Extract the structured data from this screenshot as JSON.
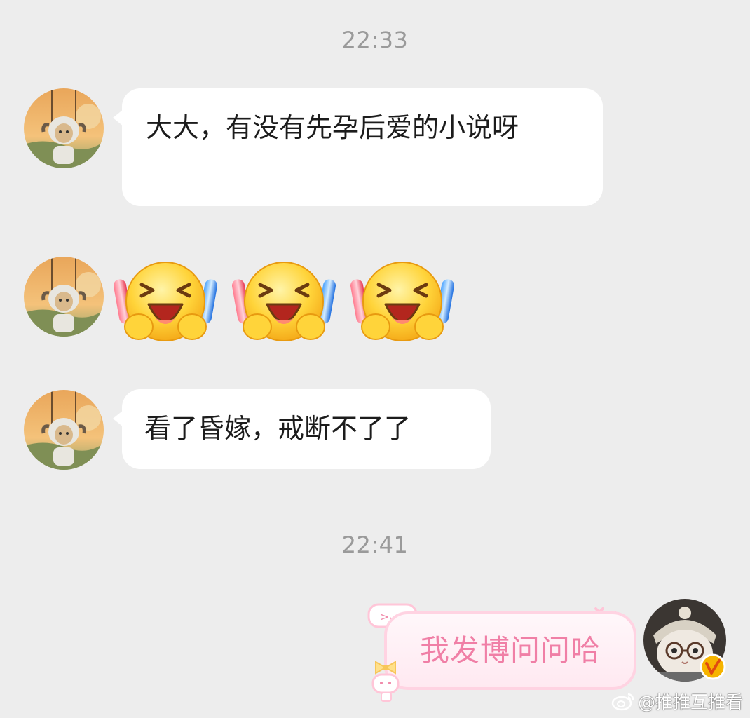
{
  "chat": {
    "timestamps": [
      "22:33",
      "22:41"
    ],
    "messages": [
      {
        "sender": "other",
        "type": "text",
        "text": "大大，有没有先孕后爱的小说呀"
      },
      {
        "sender": "other",
        "type": "sticker",
        "sticker": "cheering-face-with-glowsticks",
        "count": 3
      },
      {
        "sender": "other",
        "type": "text",
        "text": "看了昏嫁，戒断不了了"
      },
      {
        "sender": "self",
        "type": "text",
        "text": "我发博问问哈"
      }
    ]
  },
  "watermark": {
    "text": "@推推互推看",
    "icon": "weibo-logo-icon"
  },
  "colors": {
    "background": "#ededed",
    "bubble_other": "#ffffff",
    "bubble_self_text": "#f07fa6",
    "bubble_self_border": "#ffd3e2",
    "timestamp": "#9a9a9a"
  }
}
